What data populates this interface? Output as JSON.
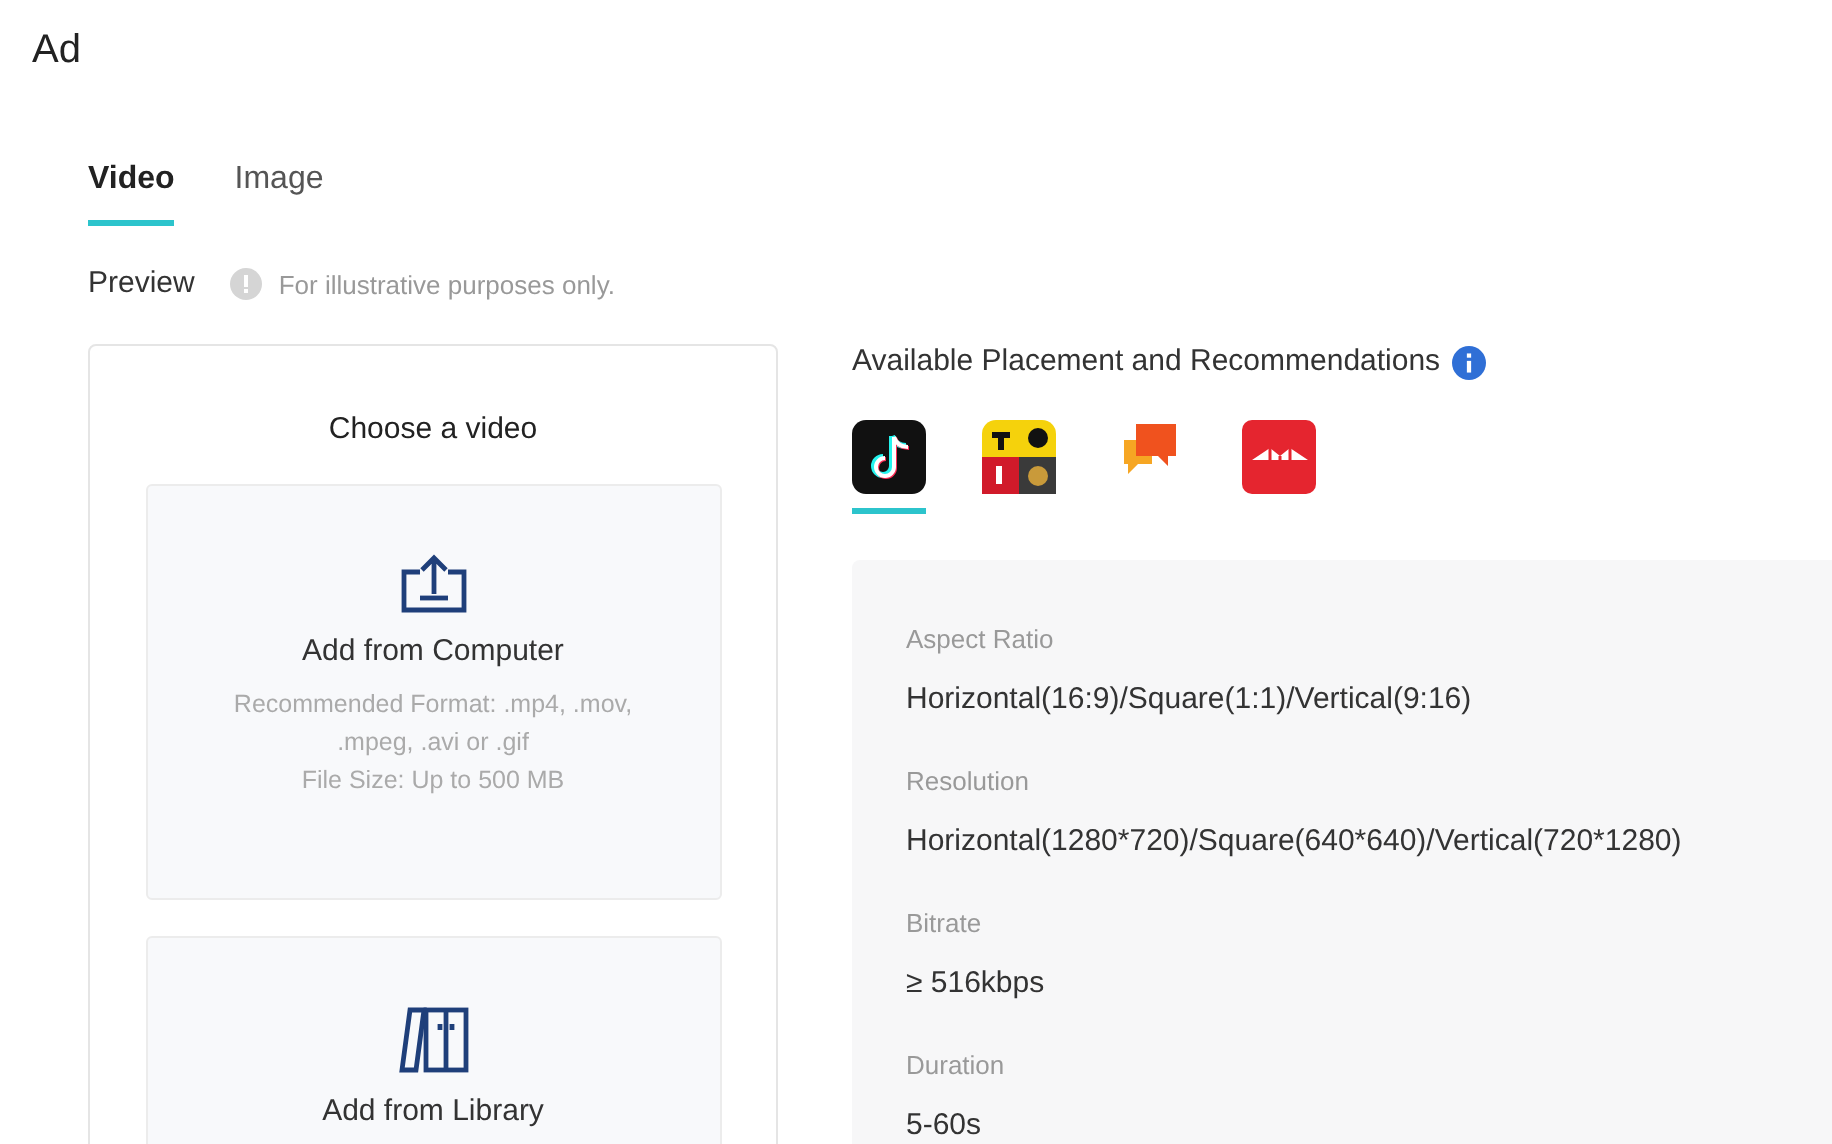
{
  "title": "Ad",
  "tabs": [
    {
      "label": "Video",
      "selected": true
    },
    {
      "label": "Image",
      "selected": false
    }
  ],
  "preview": {
    "label": "Preview",
    "note": "For illustrative purposes only."
  },
  "upload_card": {
    "heading": "Choose a video",
    "options": [
      {
        "kind": "computer",
        "label": "Add from Computer",
        "details": [
          "Recommended Format: .mp4, .mov, .mpeg, .avi or .gif",
          "File Size: Up to 500 MB"
        ]
      },
      {
        "kind": "library",
        "label": "Add from Library"
      }
    ]
  },
  "placements": {
    "heading": "Available Placement and Recommendations",
    "apps": [
      {
        "kind": "note",
        "selected": true
      },
      {
        "kind": "grid",
        "selected": false
      },
      {
        "kind": "chat",
        "selected": false
      },
      {
        "kind": "bridge",
        "selected": false
      }
    ],
    "specs": [
      {
        "label": "Aspect Ratio",
        "value": "Horizontal(16:9)/Square(1:1)/Vertical(9:16)"
      },
      {
        "label": "Resolution",
        "value": "Horizontal(1280*720)/Square(640*640)/Vertical(720*1280)"
      },
      {
        "label": "Bitrate",
        "value": "≥ 516kbps"
      },
      {
        "label": "Duration",
        "value": "5-60s"
      }
    ]
  }
}
